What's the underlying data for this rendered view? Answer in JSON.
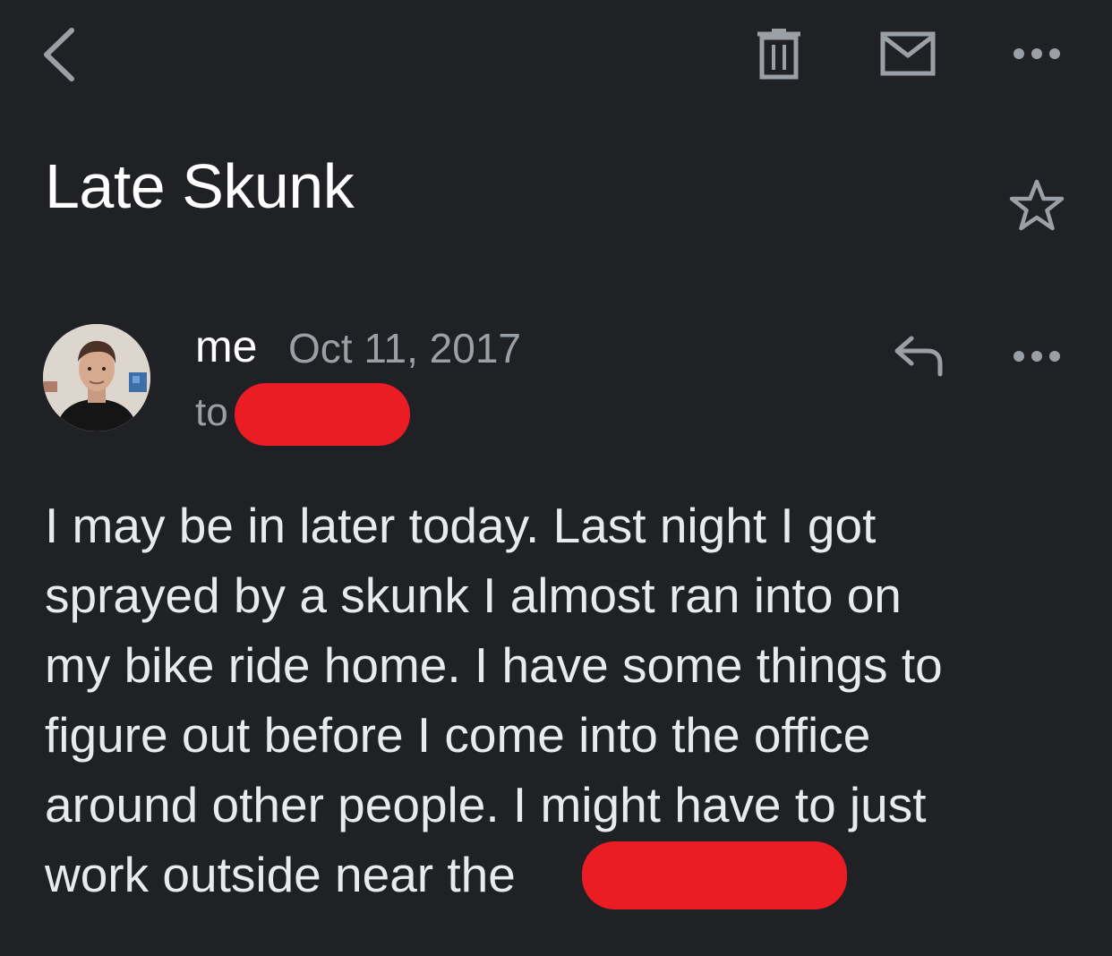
{
  "toolbar": {
    "back_icon": "chevron-left-icon",
    "delete_icon": "trash-icon",
    "mark_unread_icon": "mail-icon",
    "more_icon": "more-horizontal-icon"
  },
  "email": {
    "subject": "Late Skunk",
    "star_icon": "star-outline-icon",
    "sender": "me",
    "date": "Oct 11, 2017",
    "to_label": "to",
    "recipient_redacted_color": "#ec1c24",
    "reply_icon": "reply-icon",
    "more_icon": "more-horizontal-icon",
    "body_lines": [
      "I may be in later today. Last night I got",
      "sprayed by a skunk I almost ran into on",
      "my bike ride home. I have some things to",
      "figure out before I come into the office",
      "around other people. I might have to just",
      "work outside near the"
    ]
  },
  "colors": {
    "background": "#202124",
    "text_primary": "#ffffff",
    "text_secondary": "#9aa0a6",
    "icon": "#9aa0a6",
    "redaction": "#ec1c24"
  }
}
